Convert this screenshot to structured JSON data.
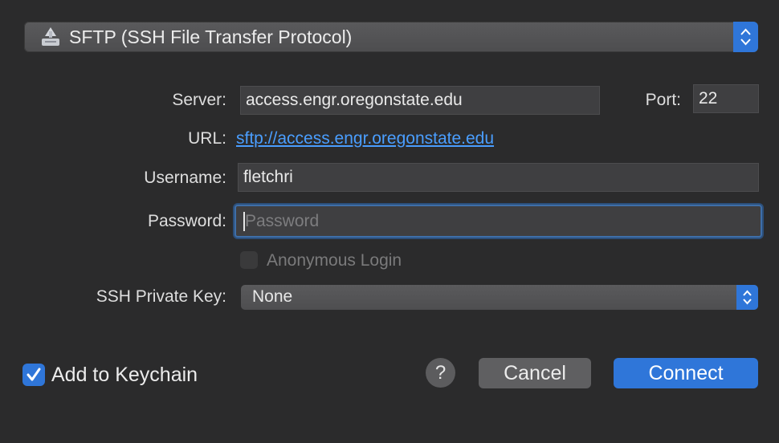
{
  "protocol": {
    "selected": "SFTP (SSH File Transfer Protocol)",
    "icon": "network-drive-icon"
  },
  "server": {
    "label": "Server:",
    "value": "access.engr.oregonstate.edu"
  },
  "port": {
    "label": "Port:",
    "value": "22"
  },
  "url": {
    "label": "URL:",
    "value": "sftp://access.engr.oregonstate.edu"
  },
  "username": {
    "label": "Username:",
    "value": "fletchri"
  },
  "password": {
    "label": "Password:",
    "placeholder": "Password",
    "value": ""
  },
  "anonymous": {
    "label": "Anonymous Login",
    "checked": false
  },
  "ssh_key": {
    "label": "SSH Private Key:",
    "selected": "None"
  },
  "keychain": {
    "label": "Add to Keychain",
    "checked": true
  },
  "buttons": {
    "help": "?",
    "cancel": "Cancel",
    "connect": "Connect"
  },
  "colors": {
    "accent": "#2f76d9",
    "link": "#4a9eff",
    "background": "#2b2b2c"
  }
}
